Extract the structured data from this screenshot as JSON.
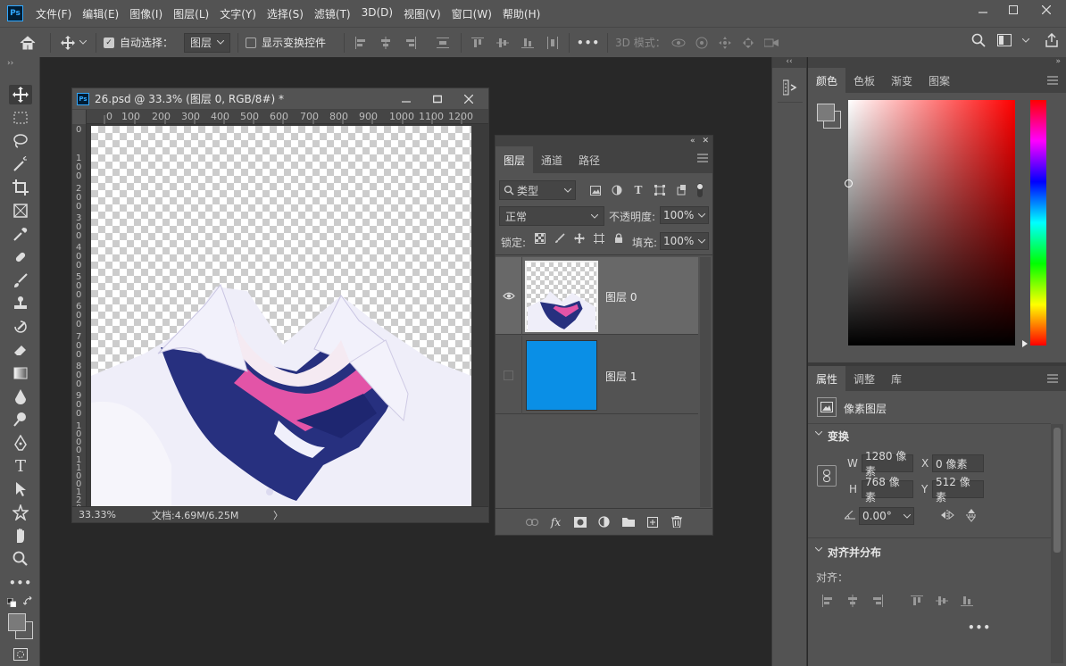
{
  "menubar": {
    "logo": "Ps",
    "items": [
      "文件(F)",
      "编辑(E)",
      "图像(I)",
      "图层(L)",
      "文字(Y)",
      "选择(S)",
      "滤镜(T)",
      "3D(D)",
      "视图(V)",
      "窗口(W)",
      "帮助(H)"
    ],
    "window_controls": [
      "minimize-icon",
      "restore-icon",
      "close-icon"
    ]
  },
  "options_bar": {
    "auto_select_label": "自动选择：",
    "auto_select_checked": true,
    "auto_select_target": "图层",
    "show_transform_label": "显示变换控件",
    "show_transform_checked": false,
    "more_label": "•••",
    "mode_3d_label": "3D 模式："
  },
  "document": {
    "title": "26.psd @ 33.3% (图层 0, RGB/8#) *",
    "ruler_h": [
      "0",
      "100",
      "200",
      "300",
      "400",
      "500",
      "600",
      "700",
      "800",
      "900",
      "1000",
      "1100",
      "1200"
    ],
    "ruler_v": [
      "0",
      "100",
      "200",
      "300",
      "400",
      "500",
      "600",
      "700",
      "800",
      "900",
      "1000",
      "1100",
      "1200"
    ],
    "zoom": "33.33%",
    "doc_size": "文档:4.69M/6.25M",
    "status_arrow": "〉"
  },
  "layers_panel": {
    "tabs": [
      "图层",
      "通道",
      "路径"
    ],
    "active_tab": 0,
    "filter_label": "类型",
    "blend_mode": "正常",
    "opacity_label": "不透明度:",
    "opacity_value": "100%",
    "lock_label": "锁定:",
    "fill_label": "填充:",
    "fill_value": "100%",
    "layers": [
      {
        "name": "图层 0",
        "visible": true,
        "selected": true
      },
      {
        "name": "图层 1",
        "visible": false,
        "selected": false,
        "color": "#0a8fe6"
      }
    ],
    "footer_icons": [
      "link-icon",
      "fx-icon",
      "mask-icon",
      "adjustment-icon",
      "folder-icon",
      "new-layer-icon",
      "trash-icon"
    ],
    "fx_label": "fx"
  },
  "color_panel": {
    "tabs": [
      "颜色",
      "色板",
      "渐变",
      "图案"
    ],
    "active_tab": 0
  },
  "properties_panel": {
    "tabs": [
      "属性",
      "调整",
      "库"
    ],
    "active_tab": 0,
    "layer_type": "像素图层",
    "transform_title": "变换",
    "w_label": "W",
    "w_value": "1280 像素",
    "h_label": "H",
    "h_value": "768 像素",
    "x_label": "X",
    "x_value": "0 像素",
    "y_label": "Y",
    "y_value": "512 像素",
    "angle_value": "0.00°",
    "align_title": "对齐并分布",
    "align_label": "对齐：",
    "more_label": "•••"
  }
}
